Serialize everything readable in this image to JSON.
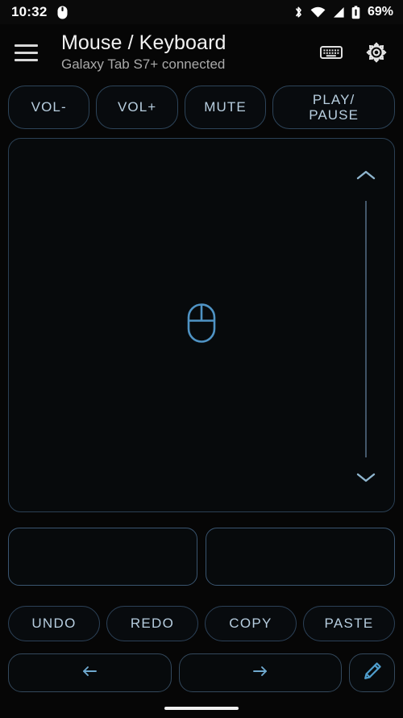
{
  "status_bar": {
    "time": "10:32",
    "mouse_indicator_icon": "mouse-icon",
    "bluetooth_icon": "bluetooth-icon",
    "wifi_icon": "wifi-icon",
    "signal_icon": "cellular-signal-icon",
    "battery_icon": "battery-icon",
    "battery_level": "69%"
  },
  "app_bar": {
    "menu_icon": "hamburger-menu-icon",
    "title": "Mouse / Keyboard",
    "subtitle": "Galaxy Tab S7+ connected",
    "keyboard_icon": "keyboard-icon",
    "settings_icon": "gear-icon"
  },
  "media_controls": {
    "buttons": [
      {
        "label": "VOL-",
        "name": "volume-down-button"
      },
      {
        "label": "VOL+",
        "name": "volume-up-button"
      },
      {
        "label": "MUTE",
        "name": "mute-button"
      },
      {
        "label": "PLAY/\nPAUSE",
        "name": "play-pause-button"
      }
    ]
  },
  "touchpad": {
    "name": "touchpad-area",
    "center_icon": "mouse-icon",
    "scroll": {
      "up_icon": "chevron-up-icon",
      "down_icon": "chevron-down-icon",
      "track": "scroll-track"
    }
  },
  "click_buttons": [
    {
      "name": "left-click-button",
      "label": ""
    },
    {
      "name": "right-click-button",
      "label": ""
    }
  ],
  "edit_controls": {
    "buttons": [
      {
        "label": "UNDO",
        "name": "undo-button"
      },
      {
        "label": "REDO",
        "name": "redo-button"
      },
      {
        "label": "COPY",
        "name": "copy-button"
      },
      {
        "label": "PASTE",
        "name": "paste-button"
      }
    ]
  },
  "nav_controls": {
    "back_icon": "arrow-left-icon",
    "forward_icon": "arrow-right-icon",
    "edit_icon": "pencil-icon"
  },
  "system_nav": {
    "gesture_bar": "home-gesture-bar"
  },
  "colors": {
    "background": "#060606",
    "accent": "#4a9fd4",
    "border": "#2d4459",
    "text_primary": "#f2f2f2",
    "text_secondary": "#a9a9a9",
    "button_text": "#b8cfe0"
  }
}
